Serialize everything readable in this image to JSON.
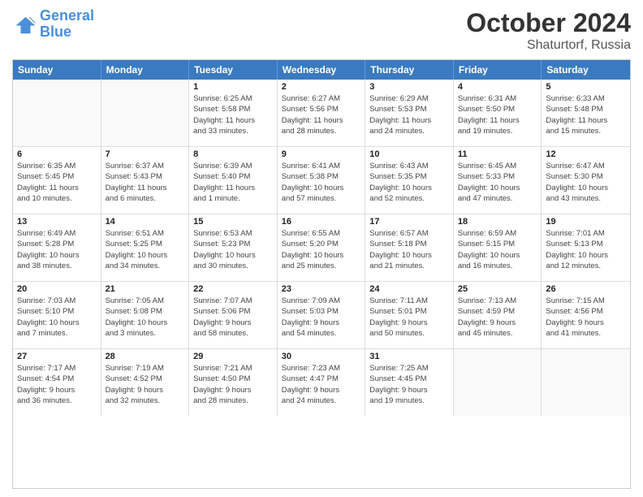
{
  "header": {
    "logo_line1": "General",
    "logo_line2": "Blue",
    "month": "October 2024",
    "location": "Shaturtorf, Russia"
  },
  "days_of_week": [
    "Sunday",
    "Monday",
    "Tuesday",
    "Wednesday",
    "Thursday",
    "Friday",
    "Saturday"
  ],
  "rows": [
    [
      {
        "day": "",
        "lines": [],
        "empty": true
      },
      {
        "day": "",
        "lines": [],
        "empty": true
      },
      {
        "day": "1",
        "lines": [
          "Sunrise: 6:25 AM",
          "Sunset: 5:58 PM",
          "Daylight: 11 hours",
          "and 33 minutes."
        ]
      },
      {
        "day": "2",
        "lines": [
          "Sunrise: 6:27 AM",
          "Sunset: 5:56 PM",
          "Daylight: 11 hours",
          "and 28 minutes."
        ]
      },
      {
        "day": "3",
        "lines": [
          "Sunrise: 6:29 AM",
          "Sunset: 5:53 PM",
          "Daylight: 11 hours",
          "and 24 minutes."
        ]
      },
      {
        "day": "4",
        "lines": [
          "Sunrise: 6:31 AM",
          "Sunset: 5:50 PM",
          "Daylight: 11 hours",
          "and 19 minutes."
        ]
      },
      {
        "day": "5",
        "lines": [
          "Sunrise: 6:33 AM",
          "Sunset: 5:48 PM",
          "Daylight: 11 hours",
          "and 15 minutes."
        ]
      }
    ],
    [
      {
        "day": "6",
        "lines": [
          "Sunrise: 6:35 AM",
          "Sunset: 5:45 PM",
          "Daylight: 11 hours",
          "and 10 minutes."
        ]
      },
      {
        "day": "7",
        "lines": [
          "Sunrise: 6:37 AM",
          "Sunset: 5:43 PM",
          "Daylight: 11 hours",
          "and 6 minutes."
        ]
      },
      {
        "day": "8",
        "lines": [
          "Sunrise: 6:39 AM",
          "Sunset: 5:40 PM",
          "Daylight: 11 hours",
          "and 1 minute."
        ]
      },
      {
        "day": "9",
        "lines": [
          "Sunrise: 6:41 AM",
          "Sunset: 5:38 PM",
          "Daylight: 10 hours",
          "and 57 minutes."
        ]
      },
      {
        "day": "10",
        "lines": [
          "Sunrise: 6:43 AM",
          "Sunset: 5:35 PM",
          "Daylight: 10 hours",
          "and 52 minutes."
        ]
      },
      {
        "day": "11",
        "lines": [
          "Sunrise: 6:45 AM",
          "Sunset: 5:33 PM",
          "Daylight: 10 hours",
          "and 47 minutes."
        ]
      },
      {
        "day": "12",
        "lines": [
          "Sunrise: 6:47 AM",
          "Sunset: 5:30 PM",
          "Daylight: 10 hours",
          "and 43 minutes."
        ]
      }
    ],
    [
      {
        "day": "13",
        "lines": [
          "Sunrise: 6:49 AM",
          "Sunset: 5:28 PM",
          "Daylight: 10 hours",
          "and 38 minutes."
        ]
      },
      {
        "day": "14",
        "lines": [
          "Sunrise: 6:51 AM",
          "Sunset: 5:25 PM",
          "Daylight: 10 hours",
          "and 34 minutes."
        ]
      },
      {
        "day": "15",
        "lines": [
          "Sunrise: 6:53 AM",
          "Sunset: 5:23 PM",
          "Daylight: 10 hours",
          "and 30 minutes."
        ]
      },
      {
        "day": "16",
        "lines": [
          "Sunrise: 6:55 AM",
          "Sunset: 5:20 PM",
          "Daylight: 10 hours",
          "and 25 minutes."
        ]
      },
      {
        "day": "17",
        "lines": [
          "Sunrise: 6:57 AM",
          "Sunset: 5:18 PM",
          "Daylight: 10 hours",
          "and 21 minutes."
        ]
      },
      {
        "day": "18",
        "lines": [
          "Sunrise: 6:59 AM",
          "Sunset: 5:15 PM",
          "Daylight: 10 hours",
          "and 16 minutes."
        ]
      },
      {
        "day": "19",
        "lines": [
          "Sunrise: 7:01 AM",
          "Sunset: 5:13 PM",
          "Daylight: 10 hours",
          "and 12 minutes."
        ]
      }
    ],
    [
      {
        "day": "20",
        "lines": [
          "Sunrise: 7:03 AM",
          "Sunset: 5:10 PM",
          "Daylight: 10 hours",
          "and 7 minutes."
        ]
      },
      {
        "day": "21",
        "lines": [
          "Sunrise: 7:05 AM",
          "Sunset: 5:08 PM",
          "Daylight: 10 hours",
          "and 3 minutes."
        ]
      },
      {
        "day": "22",
        "lines": [
          "Sunrise: 7:07 AM",
          "Sunset: 5:06 PM",
          "Daylight: 9 hours",
          "and 58 minutes."
        ]
      },
      {
        "day": "23",
        "lines": [
          "Sunrise: 7:09 AM",
          "Sunset: 5:03 PM",
          "Daylight: 9 hours",
          "and 54 minutes."
        ]
      },
      {
        "day": "24",
        "lines": [
          "Sunrise: 7:11 AM",
          "Sunset: 5:01 PM",
          "Daylight: 9 hours",
          "and 50 minutes."
        ]
      },
      {
        "day": "25",
        "lines": [
          "Sunrise: 7:13 AM",
          "Sunset: 4:59 PM",
          "Daylight: 9 hours",
          "and 45 minutes."
        ]
      },
      {
        "day": "26",
        "lines": [
          "Sunrise: 7:15 AM",
          "Sunset: 4:56 PM",
          "Daylight: 9 hours",
          "and 41 minutes."
        ]
      }
    ],
    [
      {
        "day": "27",
        "lines": [
          "Sunrise: 7:17 AM",
          "Sunset: 4:54 PM",
          "Daylight: 9 hours",
          "and 36 minutes."
        ]
      },
      {
        "day": "28",
        "lines": [
          "Sunrise: 7:19 AM",
          "Sunset: 4:52 PM",
          "Daylight: 9 hours",
          "and 32 minutes."
        ]
      },
      {
        "day": "29",
        "lines": [
          "Sunrise: 7:21 AM",
          "Sunset: 4:50 PM",
          "Daylight: 9 hours",
          "and 28 minutes."
        ]
      },
      {
        "day": "30",
        "lines": [
          "Sunrise: 7:23 AM",
          "Sunset: 4:47 PM",
          "Daylight: 9 hours",
          "and 24 minutes."
        ]
      },
      {
        "day": "31",
        "lines": [
          "Sunrise: 7:25 AM",
          "Sunset: 4:45 PM",
          "Daylight: 9 hours",
          "and 19 minutes."
        ]
      },
      {
        "day": "",
        "lines": [],
        "empty": true
      },
      {
        "day": "",
        "lines": [],
        "empty": true
      }
    ]
  ]
}
